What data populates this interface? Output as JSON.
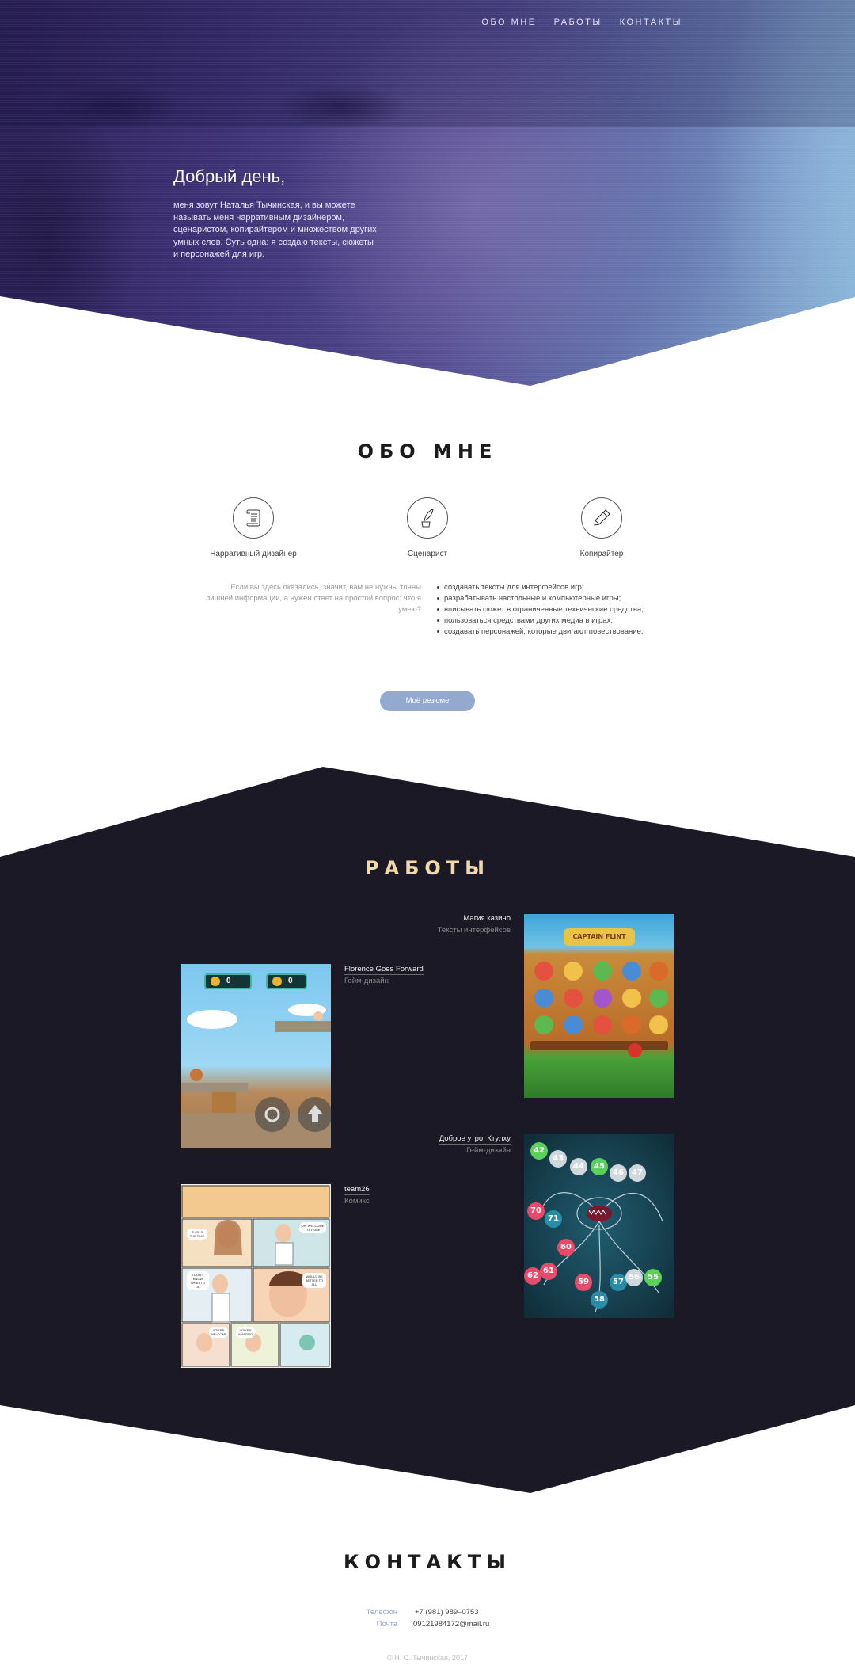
{
  "nav": {
    "about": "ОБО МНЕ",
    "works": "РАБОТЫ",
    "contacts": "КОНТАКТЫ"
  },
  "hero": {
    "title": "Добрый день,",
    "description": "меня зовут Наталья Тычинская, и вы можете называть меня нарративным дизайнером, сценаристом, копирайтером и множеством других умных слов. Суть одна: я создаю тексты, сюжеты и персонажей для игр."
  },
  "about": {
    "title": "ОБО МНЕ",
    "skills": [
      {
        "label": "Нарративный дизайнер",
        "icon": "scroll-icon"
      },
      {
        "label": "Сценарист",
        "icon": "quill-inkwell-icon"
      },
      {
        "label": "Копирайтер",
        "icon": "pen-icon"
      }
    ],
    "intro": "Если вы здесь оказались, значит, вам не нужны тонны лишней информации, а нужен ответ на простой вопрос: что я умею?",
    "abilities": [
      "создавать тексты для интерфейсов игр;",
      "разрабатывать настольные и компьютерные игры;",
      "вписывать сюжет в ограниченные технические средства;",
      "пользоваться средствами других медиа в играх;",
      "создавать персонажей, которые двигают повествование."
    ],
    "resume_button": "Моё резюме",
    "resume_button_color": "#93a9d0"
  },
  "works": {
    "title": "РАБОТЫ",
    "title_color": "#f3d9a6",
    "items": [
      {
        "name": "Магия казино",
        "type": "Тексты интерфейсов",
        "thumb": "Captain Flint slot screenshot"
      },
      {
        "name": "Florence Goes Forward",
        "type": "Гейм-дизайн",
        "thumb": "platformer game screenshot"
      },
      {
        "name": "Доброе утро, Ктулху",
        "type": "Гейм-дизайн",
        "thumb": "octopus numbers game screenshot"
      },
      {
        "name": "team26",
        "type": "Комикс",
        "thumb": "comic page"
      }
    ],
    "game_counters": [
      "0",
      "0"
    ],
    "number_balls": [
      "42",
      "43",
      "44",
      "45",
      "46",
      "47",
      "70",
      "71",
      "60",
      "61",
      "62",
      "59",
      "57",
      "58",
      "56",
      "55"
    ],
    "slot_logo": "CAPTAIN FLINT",
    "comic_bubbles": [
      "THIS IS THE TIME",
      "OH, WELCOME TO TEAM!",
      "I DON'T KNOW WHAT TO DO",
      "WOULD BE BETTER TO ALL",
      "YOU'RE WELCOME",
      "YOU'RE AMAZING"
    ]
  },
  "contacts": {
    "title": "КОНТАКТЫ",
    "phone_label": "Телефон",
    "phone": "+7 (981) 989–0753",
    "email_label": "Почта",
    "email": "09121984172@mail.ru"
  },
  "footer": "© Н. С. Тычинская, 2017"
}
